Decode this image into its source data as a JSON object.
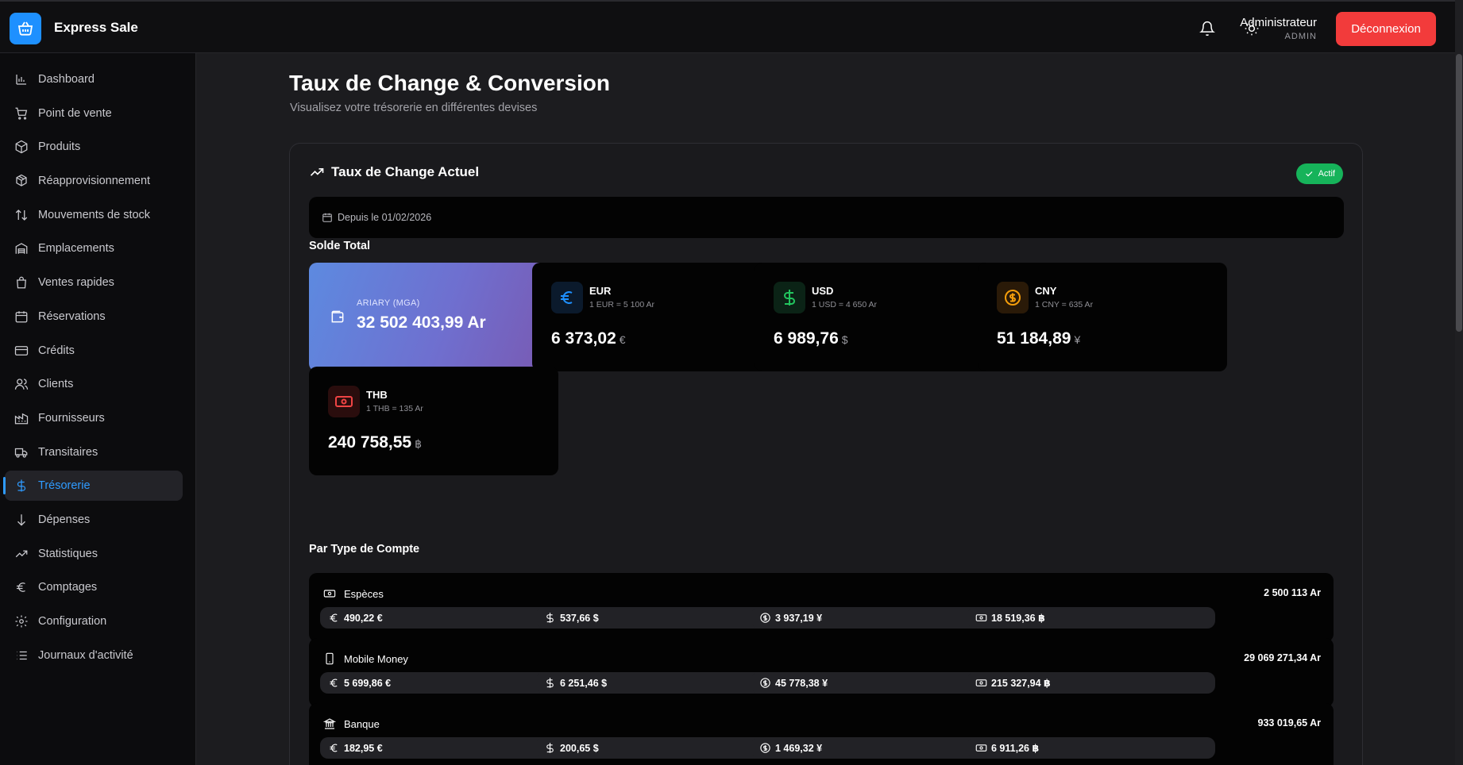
{
  "app": {
    "title": "Express Sale"
  },
  "header": {
    "user_name": "Administrateur",
    "user_role": "ADMIN",
    "logout_label": "Déconnexion"
  },
  "sidebar": {
    "items": [
      {
        "label": "Dashboard",
        "icon": "chart-icon"
      },
      {
        "label": "Point de vente",
        "icon": "cart-icon"
      },
      {
        "label": "Produits",
        "icon": "box-icon"
      },
      {
        "label": "Réapprovisionnement",
        "icon": "restock-icon"
      },
      {
        "label": "Mouvements de stock",
        "icon": "arrows-updown-icon"
      },
      {
        "label": "Emplacements",
        "icon": "warehouse-icon"
      },
      {
        "label": "Ventes rapides",
        "icon": "bag-icon"
      },
      {
        "label": "Réservations",
        "icon": "calendar-icon"
      },
      {
        "label": "Crédits",
        "icon": "credit-card-icon"
      },
      {
        "label": "Clients",
        "icon": "users-icon"
      },
      {
        "label": "Fournisseurs",
        "icon": "factory-icon"
      },
      {
        "label": "Transitaires",
        "icon": "truck-icon"
      },
      {
        "label": "Trésorerie",
        "icon": "dollar-icon",
        "active": true
      },
      {
        "label": "Dépenses",
        "icon": "arrow-down-icon"
      },
      {
        "label": "Statistiques",
        "icon": "trending-icon"
      },
      {
        "label": "Comptages",
        "icon": "euro-icon"
      },
      {
        "label": "Configuration",
        "icon": "gear-icon"
      },
      {
        "label": "Journaux d'activité",
        "icon": "list-icon"
      }
    ]
  },
  "page": {
    "title": "Taux de Change & Conversion",
    "subtitle": "Visualisez votre trésorerie en différentes devises"
  },
  "rates_card": {
    "title": "Taux de Change Actuel",
    "status": "Actif",
    "since": "Depuis le 01/02/2026",
    "total_title": "Solde Total",
    "mga": {
      "label": "ARIARY (MGA)",
      "value": "32 502 403,99 Ar"
    },
    "currencies": [
      {
        "code": "EUR",
        "rate": "1 EUR = 5 100 Ar",
        "value": "6 373,02",
        "symbol": "€",
        "color": "#1e90ff",
        "bg": "#0b1a2c",
        "icon": "euro-icon"
      },
      {
        "code": "USD",
        "rate": "1 USD = 4 650 Ar",
        "value": "6 989,76",
        "symbol": "$",
        "color": "#22c55e",
        "bg": "#0b2316",
        "icon": "dollar-icon"
      },
      {
        "code": "CNY",
        "rate": "1 CNY = 635 Ar",
        "value": "51 184,89",
        "symbol": "¥",
        "color": "#f59e0b",
        "bg": "#2a1a08",
        "icon": "coin-icon"
      },
      {
        "code": "THB",
        "rate": "1 THB = 135 Ar",
        "value": "240 758,55",
        "symbol": "฿",
        "color": "#ef4444",
        "bg": "#2a0d0d",
        "icon": "banknote-icon"
      }
    ],
    "accounts_title": "Par Type de Compte",
    "accounts": [
      {
        "name": "Espèces",
        "icon": "banknote-icon",
        "total": "2 500 113 Ar",
        "eur": "490,22 €",
        "usd": "537,66 $",
        "cny": "3 937,19 ¥",
        "thb": "18 519,36 ฿"
      },
      {
        "name": "Mobile Money",
        "icon": "phone-icon",
        "total": "29 069 271,34 Ar",
        "eur": "5 699,86 €",
        "usd": "6 251,46 $",
        "cny": "45 778,38 ¥",
        "thb": "215 327,94 ฿"
      },
      {
        "name": "Banque",
        "icon": "bank-icon",
        "total": "933 019,65 Ar",
        "eur": "182,95 €",
        "usd": "200,65 $",
        "cny": "1 469,32 ¥",
        "thb": "6 911,26 ฿"
      }
    ]
  }
}
